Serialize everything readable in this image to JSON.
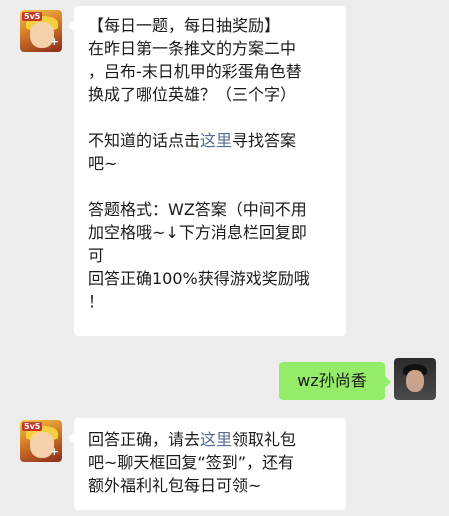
{
  "messages": [
    {
      "lines": [
        "【每日一题，每日抽奖励】",
        "在昨日第一条推文的方案二中",
        "，吕布-末日机甲的彩蛋角色替",
        "换成了哪位英雄？（三个字）",
        "",
        "",
        "吧~",
        "",
        "答题格式：WZ答案（中间不用",
        "加空格哦~↓下方消息栏回复即",
        "可",
        "回答正确100%获得游戏奖励哦",
        "！"
      ],
      "hint_prefix": "不知道的话点击",
      "hint_link": "这里",
      "hint_suffix": "寻找答案"
    },
    {
      "text": "wz孙尚香"
    },
    {
      "line1_prefix": "回答正确，请去",
      "line1_link": "这里",
      "line1_suffix": "领取礼包",
      "line2": "吧~聊天框回复“签到”，还有",
      "line3": "额外福利礼包每日可领~"
    }
  ],
  "game_avatar_badge": "5v5"
}
